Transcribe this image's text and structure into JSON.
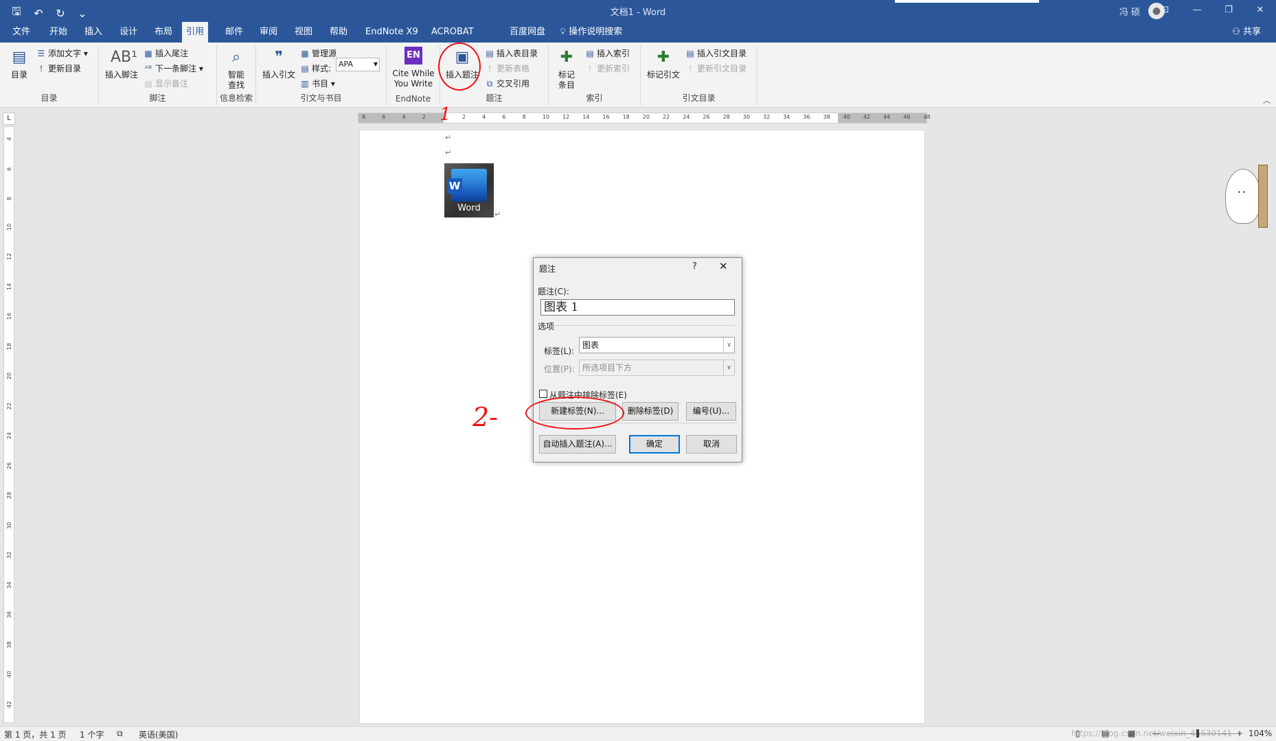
{
  "titlebar": {
    "doc_title": "文档1 - Word",
    "user": "冯 硕",
    "qat": {
      "save": "🖫",
      "undo": "↶",
      "redo": "↻",
      "customize": "⌄"
    },
    "window": {
      "restore_ribbon": "⊡",
      "minimize": "—",
      "maximize": "❐",
      "close": "✕"
    }
  },
  "tabs": [
    "文件",
    "开始",
    "插入",
    "设计",
    "布局",
    "引用",
    "邮件",
    "审阅",
    "视图",
    "帮助",
    "EndNote X9",
    "ACROBAT",
    "百度网盘"
  ],
  "active_tab": "引用",
  "tell_me": "操作说明搜索",
  "share": "共享",
  "ribbon": {
    "toc": {
      "big": "目录",
      "add_text": "添加文字",
      "update_toc": "更新目录",
      "label": "目录"
    },
    "footnotes": {
      "big": "插入脚注",
      "insert_endnote": "插入尾注",
      "next_footnote": "下一条脚注",
      "show_notes": "显示备注",
      "label": "脚注"
    },
    "research": {
      "big": "智能\n查找",
      "label": "信息检索"
    },
    "citations": {
      "big": "插入引文",
      "manage_sources": "管理源",
      "style_label": "样式:",
      "style_value": "APA",
      "bibliography": "书目",
      "label": "引文与书目"
    },
    "endnote": {
      "big": "Cite While\nYou Write",
      "label": "EndNote"
    },
    "captions": {
      "big": "插入题注",
      "insert_tof": "插入表目录",
      "update_table": "更新表格",
      "cross_ref": "交叉引用",
      "label": "题注"
    },
    "index": {
      "big": "标记\n条目",
      "insert_index": "插入索引",
      "update_index": "更新索引",
      "label": "索引"
    },
    "toa": {
      "big": "标记引文",
      "insert_toa": "插入引文目录",
      "update_toa": "更新引文目录",
      "label": "引文目录"
    }
  },
  "ruler": {
    "h_ticks": [
      "8",
      "6",
      "4",
      "2",
      "",
      "2",
      "4",
      "6",
      "8",
      "10",
      "12",
      "14",
      "16",
      "18",
      "20",
      "22",
      "24",
      "26",
      "28",
      "30",
      "32",
      "34",
      "36",
      "38",
      "40",
      "42",
      "44",
      "46",
      "48"
    ],
    "v_ticks": [
      "4",
      "6",
      "8",
      "10",
      "12",
      "14",
      "16",
      "18",
      "20",
      "22",
      "24",
      "26",
      "28",
      "30",
      "32",
      "34",
      "36",
      "38",
      "40",
      "42"
    ]
  },
  "document": {
    "icon_label": "Word",
    "icon_letter": "W"
  },
  "dialog": {
    "title": "题注",
    "help": "?",
    "close": "✕",
    "caption_label": "题注(C):",
    "caption_value": "图表 1",
    "options_label": "选项",
    "label_label": "标签(L):",
    "label_value": "图表",
    "position_label": "位置(P):",
    "position_value": "所选项目下方",
    "exclude_label": "从题注中排除标签(E)",
    "new_label_btn": "新建标签(N)...",
    "delete_label_btn": "删除标签(D)",
    "numbering_btn": "编号(U)...",
    "autocaption_btn": "自动插入题注(A)...",
    "ok_btn": "确定",
    "cancel_btn": "取消"
  },
  "annotations": {
    "step1": "1",
    "step2": "2-"
  },
  "statusbar": {
    "page": "第 1 页，共 1 页",
    "words": "1 个字",
    "language": "英语(美国)",
    "watermark": "https://blog.csdn.net/weixin_45530141",
    "zoom": "104%"
  },
  "colors": {
    "word_blue": "#2b579a",
    "annotation_red": "#e11111"
  }
}
